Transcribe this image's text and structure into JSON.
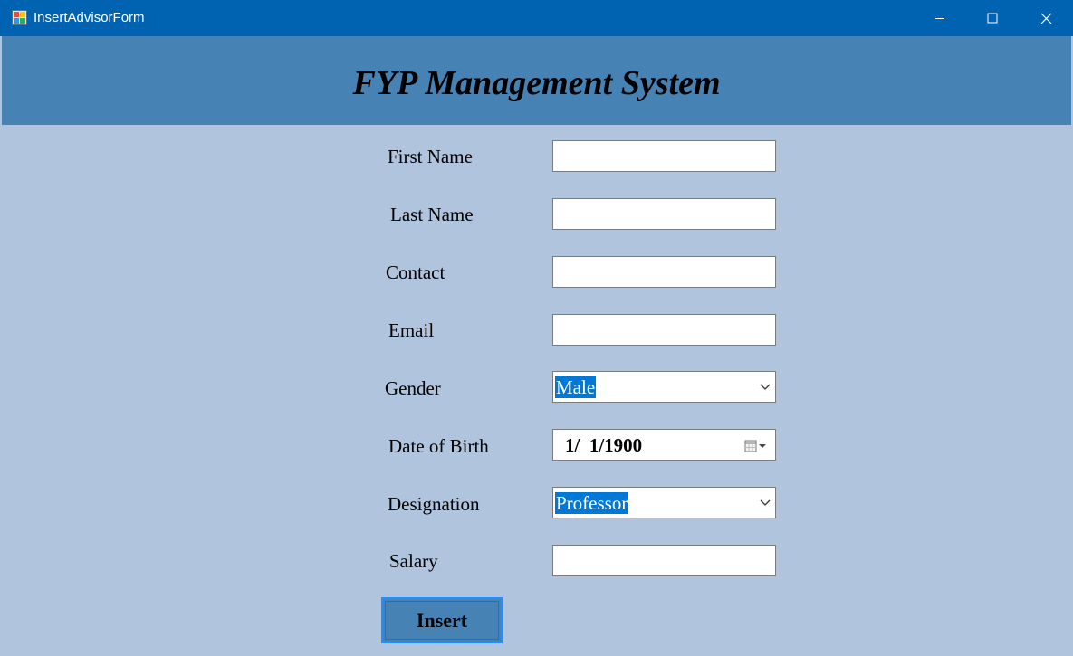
{
  "window": {
    "title": "InsertAdvisorForm"
  },
  "header": {
    "title": "FYP Management System"
  },
  "form": {
    "first_name": {
      "label": "First Name",
      "value": ""
    },
    "last_name": {
      "label": "Last Name",
      "value": ""
    },
    "contact": {
      "label": "Contact",
      "value": ""
    },
    "email": {
      "label": "Email",
      "value": ""
    },
    "gender": {
      "label": "Gender",
      "selected": "Male"
    },
    "dob": {
      "label": "Date of Birth",
      "value": "1/  1/1900"
    },
    "designation": {
      "label": "Designation",
      "selected": "Professor"
    },
    "salary": {
      "label": "Salary",
      "value": ""
    }
  },
  "actions": {
    "insert_label": "Insert"
  },
  "colors": {
    "titlebar": "#0063b1",
    "header": "#4682b4",
    "form_background": "#b0c4de",
    "selection": "#0078d7",
    "button": "#4682b4",
    "button_border": "#1e90ff"
  }
}
